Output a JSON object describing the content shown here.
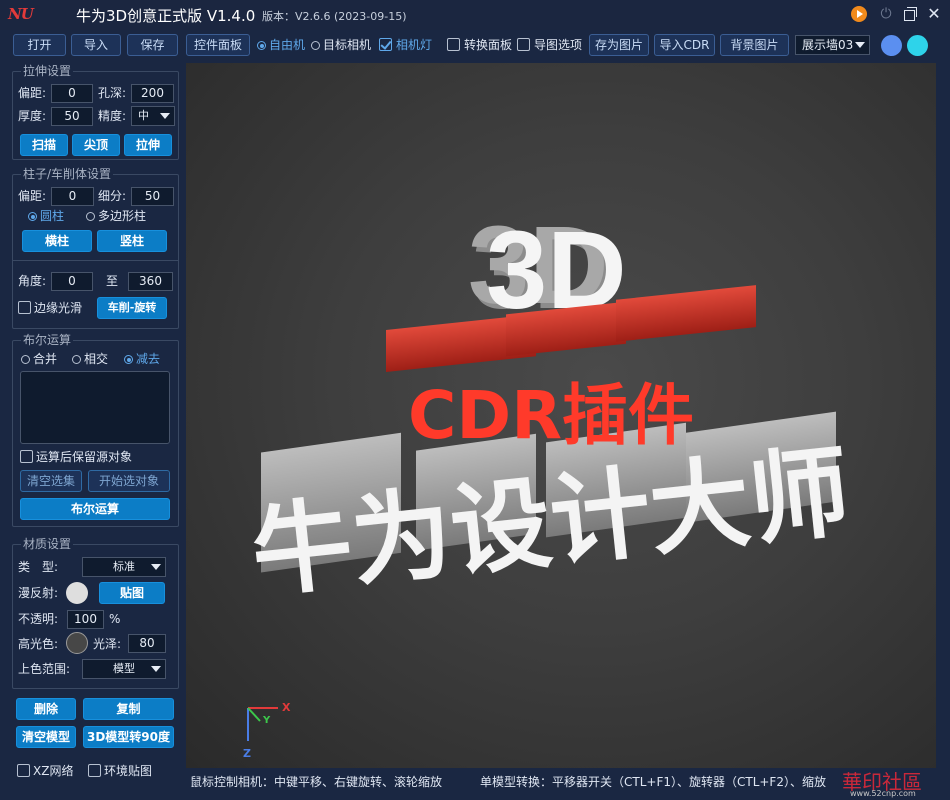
{
  "app": {
    "logo_text": "NU",
    "title": "牛为3D创意正式版 V1.4.0",
    "version": "版本：V2.6.6 (2023-09-15)"
  },
  "toolbar": {
    "open": "打开",
    "import": "导入",
    "save": "保存",
    "control_panel": "控件面板",
    "free_camera": "自由机",
    "target_camera": "目标相机",
    "camera_light": "相机灯",
    "transform_panel": "转换面板",
    "export_options": "导图选项",
    "save_image": "存为图片",
    "import_cdr": "导入CDR",
    "background_image": "背景图片",
    "display_wall": "展示墙03",
    "swatch_colors": [
      "#5b8ff0",
      "#2ed3ea"
    ]
  },
  "extrude": {
    "title": "拉伸设置",
    "offset_label": "偏距:",
    "offset": "0",
    "hole_depth_label": "孔深:",
    "hole_depth": "200",
    "thickness_label": "厚度:",
    "thickness": "50",
    "precision_label": "精度:",
    "precision": "中",
    "scan": "扫描",
    "apex": "尖顶",
    "stretch": "拉伸"
  },
  "column": {
    "title": "柱子/车削体设置",
    "offset_label": "偏距:",
    "offset": "0",
    "subdiv_label": "细分:",
    "subdiv": "50",
    "cylinder": "圆柱",
    "polygon": "多边形柱",
    "horizontal": "横柱",
    "vertical": "竖柱",
    "angle_label": "角度:",
    "angle_from": "0",
    "to_label": "至",
    "angle_to": "360",
    "smooth_edges": "边缘光滑",
    "lathe_rotate": "车削-旋转"
  },
  "boolean": {
    "title": "布尔运算",
    "union": "合并",
    "intersect": "相交",
    "subtract": "减去",
    "keep_source": "运算后保留源对象",
    "clear_selection": "清空选集",
    "start_selection": "开始选对象",
    "run": "布尔运算"
  },
  "material": {
    "title": "材质设置",
    "type_label": "类　型:",
    "type": "标准",
    "diffuse_label": "漫反射:",
    "texture": "贴图",
    "opacity_label": "不透明:",
    "opacity": "100",
    "opacity_unit": "%",
    "highlight_label": "高光色:",
    "gloss_label": "光泽:",
    "gloss": "80",
    "color_range_label": "上色范围:",
    "color_range": "模型"
  },
  "actions": {
    "delete": "删除",
    "copy": "复制",
    "clear_model": "清空模型",
    "rotate_90": "3D模型转90度",
    "xz_grid": "XZ网络",
    "env_map": "环境贴图"
  },
  "scene": {
    "line1": "3D",
    "line2": "CDR插件",
    "line3": "牛为设计大师",
    "axis_x": "X",
    "axis_y": "Y",
    "axis_z": "Z"
  },
  "status": {
    "mouse_hint": "鼠标控制相机：中键平移、右键旋转、滚轮缩放",
    "single_model": "单模型转换：平移器开关（CTL+F1）、旋转器（CTL+F2）、缩放",
    "watermark": "華印社區",
    "watermark_url": "www.52cnp.com"
  }
}
